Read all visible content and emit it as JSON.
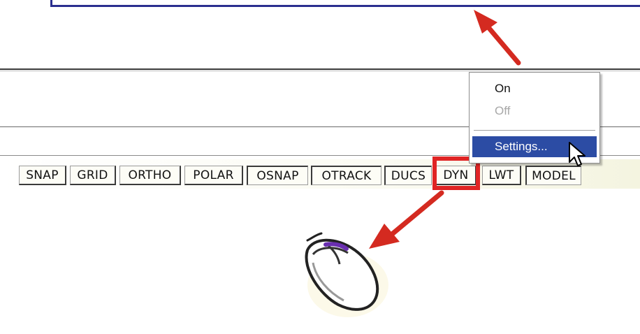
{
  "status_bar": {
    "buttons": [
      {
        "label": "SNAP"
      },
      {
        "label": "GRID"
      },
      {
        "label": "ORTHO"
      },
      {
        "label": "POLAR"
      },
      {
        "label": "OSNAP"
      },
      {
        "label": "OTRACK"
      },
      {
        "label": "DUCS"
      },
      {
        "label": "DYN"
      },
      {
        "label": "LWT"
      },
      {
        "label": "MODEL"
      }
    ]
  },
  "context_menu": {
    "items": [
      {
        "label": "On",
        "state": "enabled"
      },
      {
        "label": "Off",
        "state": "disabled"
      },
      {
        "label": "Settings...",
        "state": "highlighted"
      }
    ]
  },
  "icons": {
    "arrow": "red-arrow-icon",
    "cursor": "mouse-pointer-icon",
    "mouse": "computer-mouse-icon"
  },
  "colors": {
    "highlight": "#e02424",
    "menu_selection": "#2c4ca4",
    "frame": "#2b2f8f"
  }
}
